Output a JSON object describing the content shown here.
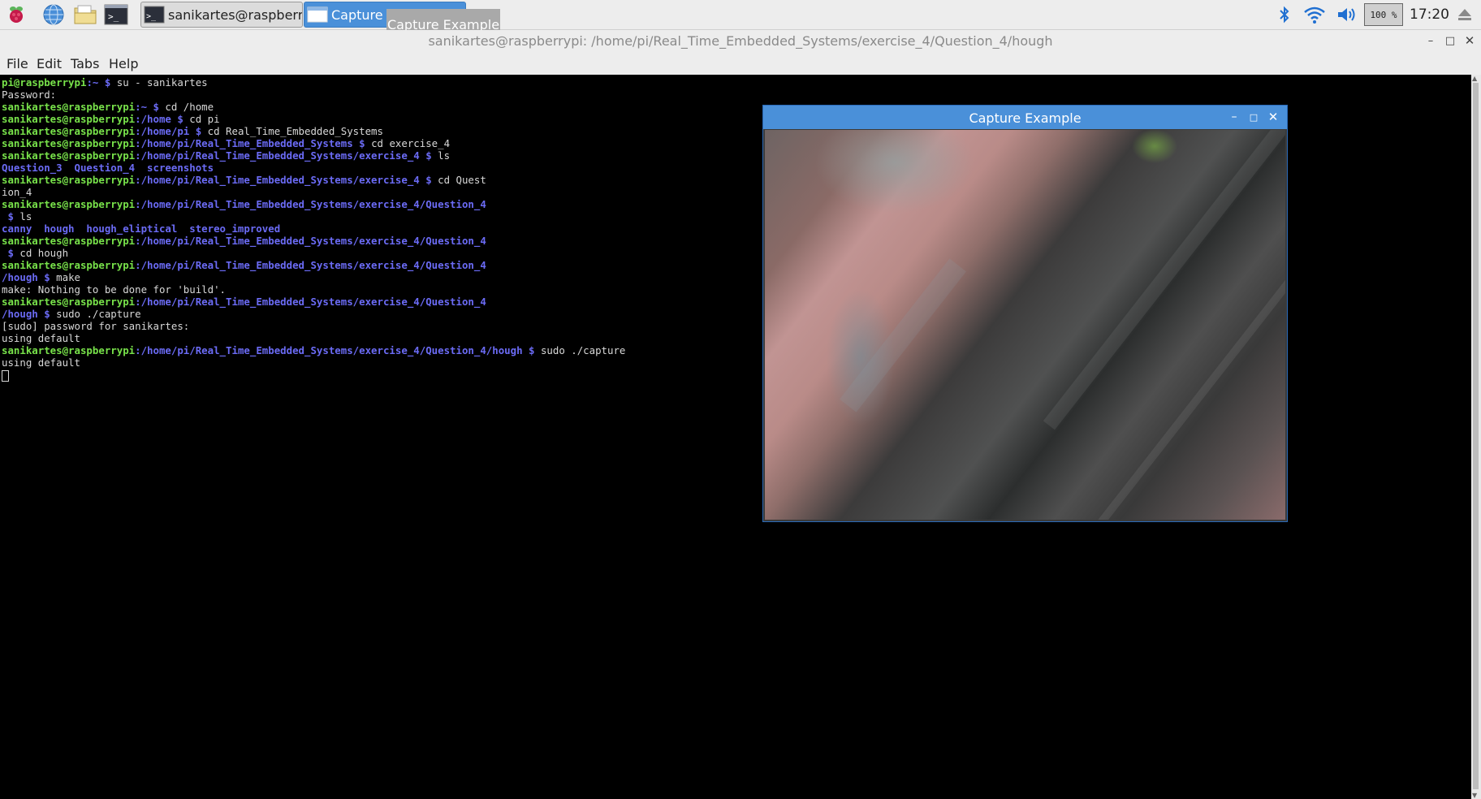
{
  "taskbar": {
    "launchers": [
      "raspberry-menu-icon",
      "web-browser-icon",
      "file-manager-icon",
      "terminal-icon"
    ],
    "tasks": [
      {
        "label": "sanikartes@raspberr...",
        "icon": "terminal-icon",
        "active": false
      },
      {
        "label": "Capture E",
        "icon": "window-icon",
        "active": true
      }
    ],
    "tooltip": "Capture Example",
    "tray": {
      "icons": [
        "bluetooth-icon",
        "wifi-icon",
        "volume-icon"
      ],
      "battery": "100 %",
      "clock": "17:20",
      "eject": "eject-icon"
    }
  },
  "terminal": {
    "title": "sanikartes@raspberrypi: /home/pi/Real_Time_Embedded_Systems/exercise_4/Question_4/hough",
    "menu": [
      "File",
      "Edit",
      "Tabs",
      "Help"
    ],
    "lines": [
      [
        {
          "t": "pi@raspberrypi",
          "c": "p"
        },
        {
          "t": ":~ $",
          "c": "d"
        },
        {
          "t": " su - sanikartes",
          "c": "c"
        }
      ],
      [
        {
          "t": "Password:",
          "c": "c"
        }
      ],
      [
        {
          "t": "sanikartes@raspberrypi",
          "c": "p"
        },
        {
          "t": ":~ $",
          "c": "d"
        },
        {
          "t": " cd /home",
          "c": "c"
        }
      ],
      [
        {
          "t": "sanikartes@raspberrypi",
          "c": "p"
        },
        {
          "t": ":/home $",
          "c": "d"
        },
        {
          "t": " cd pi",
          "c": "c"
        }
      ],
      [
        {
          "t": "sanikartes@raspberrypi",
          "c": "p"
        },
        {
          "t": ":/home/pi $",
          "c": "d"
        },
        {
          "t": " cd Real_Time_Embedded_Systems",
          "c": "c"
        }
      ],
      [
        {
          "t": "sanikartes@raspberrypi",
          "c": "p"
        },
        {
          "t": ":/home/pi/Real_Time_Embedded_Systems $",
          "c": "d"
        },
        {
          "t": " cd exercise_4",
          "c": "c"
        }
      ],
      [
        {
          "t": "sanikartes@raspberrypi",
          "c": "p"
        },
        {
          "t": ":/home/pi/Real_Time_Embedded_Systems/exercise_4 $",
          "c": "d"
        },
        {
          "t": " ls",
          "c": "c"
        }
      ],
      [
        {
          "t": "Question_3  Question_4  screenshots",
          "c": "d"
        }
      ],
      [
        {
          "t": "sanikartes@raspberrypi",
          "c": "p"
        },
        {
          "t": ":/home/pi/Real_Time_Embedded_Systems/exercise_4 $",
          "c": "d"
        },
        {
          "t": " cd Quest",
          "c": "c"
        }
      ],
      [
        {
          "t": "ion_4",
          "c": "c"
        }
      ],
      [
        {
          "t": "sanikartes@raspberrypi",
          "c": "p"
        },
        {
          "t": ":/home/pi/Real_Time_Embedded_Systems/exercise_4/Question_4",
          "c": "d"
        }
      ],
      [
        {
          "t": " $",
          "c": "d"
        },
        {
          "t": " ls",
          "c": "c"
        }
      ],
      [
        {
          "t": "canny  hough  hough_eliptical  stereo_improved",
          "c": "d"
        }
      ],
      [
        {
          "t": "sanikartes@raspberrypi",
          "c": "p"
        },
        {
          "t": ":/home/pi/Real_Time_Embedded_Systems/exercise_4/Question_4",
          "c": "d"
        }
      ],
      [
        {
          "t": " $",
          "c": "d"
        },
        {
          "t": " cd hough",
          "c": "c"
        }
      ],
      [
        {
          "t": "sanikartes@raspberrypi",
          "c": "p"
        },
        {
          "t": ":/home/pi/Real_Time_Embedded_Systems/exercise_4/Question_4",
          "c": "d"
        }
      ],
      [
        {
          "t": "/hough $",
          "c": "d"
        },
        {
          "t": " make",
          "c": "c"
        }
      ],
      [
        {
          "t": "make: Nothing to be done for 'build'.",
          "c": "c"
        }
      ],
      [
        {
          "t": "sanikartes@raspberrypi",
          "c": "p"
        },
        {
          "t": ":/home/pi/Real_Time_Embedded_Systems/exercise_4/Question_4",
          "c": "d"
        }
      ],
      [
        {
          "t": "/hough $",
          "c": "d"
        },
        {
          "t": " sudo ./capture",
          "c": "c"
        }
      ],
      [
        {
          "t": "[sudo] password for sanikartes:",
          "c": "c"
        }
      ],
      [
        {
          "t": "using default",
          "c": "c"
        }
      ],
      [
        {
          "t": "sanikartes@raspberrypi",
          "c": "p"
        },
        {
          "t": ":/home/pi/Real_Time_Embedded_Systems/exercise_4/Question_4/hough $",
          "c": "d"
        },
        {
          "t": " sudo ./capture",
          "c": "c"
        }
      ],
      [
        {
          "t": "using default",
          "c": "c"
        }
      ]
    ]
  },
  "capture_window": {
    "title": "Capture Example"
  },
  "colors": {
    "prompt_user": "#78e24a",
    "prompt_path": "#6b6bf5",
    "terminal_text": "#d8d8d8",
    "terminal_bg": "#000000",
    "active_title": "#4a90d9",
    "panel_bg": "#ededed"
  }
}
